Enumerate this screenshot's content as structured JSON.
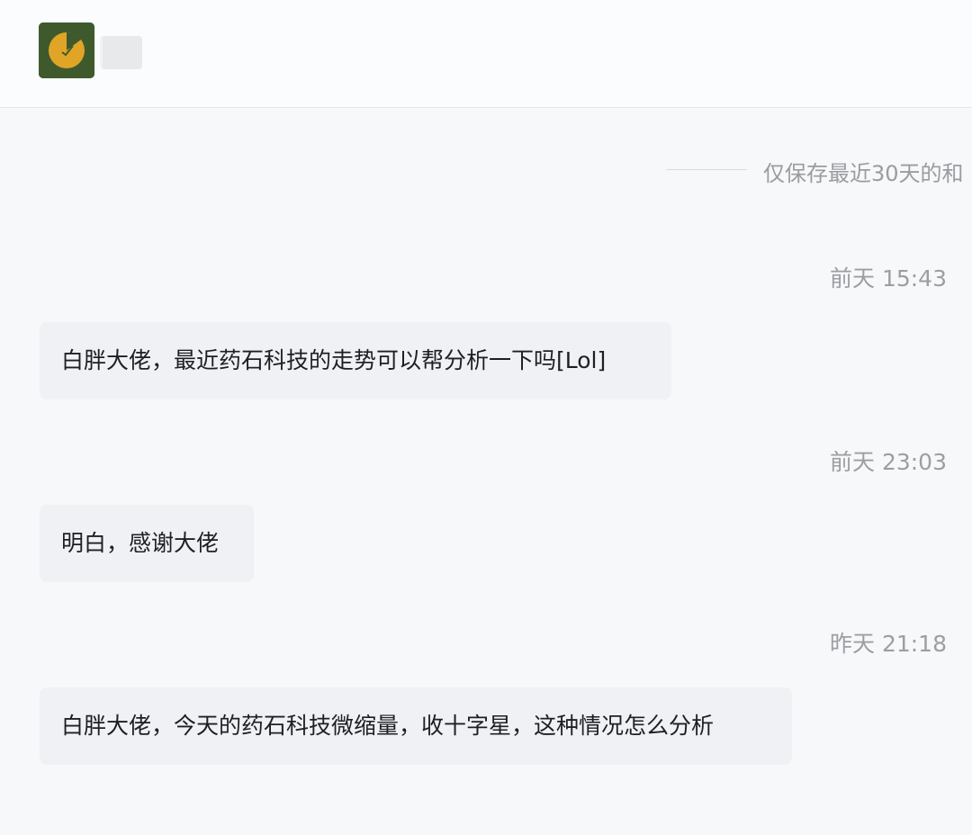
{
  "header": {
    "avatar_icon": "yellow-pie-logo-icon",
    "contact_name": ""
  },
  "notice": {
    "text": "仅保存最近30天的和"
  },
  "messages": [
    {
      "timestamp": "前天 15:43",
      "text": "白胖大佬，最近药石科技的走势可以帮分析一下吗[Lol]"
    },
    {
      "timestamp": "前天 23:03",
      "text": "明白，感谢大佬"
    },
    {
      "timestamp": "昨天 21:18",
      "text": "白胖大佬，今天的药石科技微缩量，收十字星，这种情况怎么分析"
    }
  ],
  "colors": {
    "background": "#f7f8fa",
    "bubble": "#f0f1f4",
    "timestamp_text": "#9c9ea2",
    "avatar_bg": "#3e5a2d",
    "avatar_pie": "#e0a526"
  }
}
